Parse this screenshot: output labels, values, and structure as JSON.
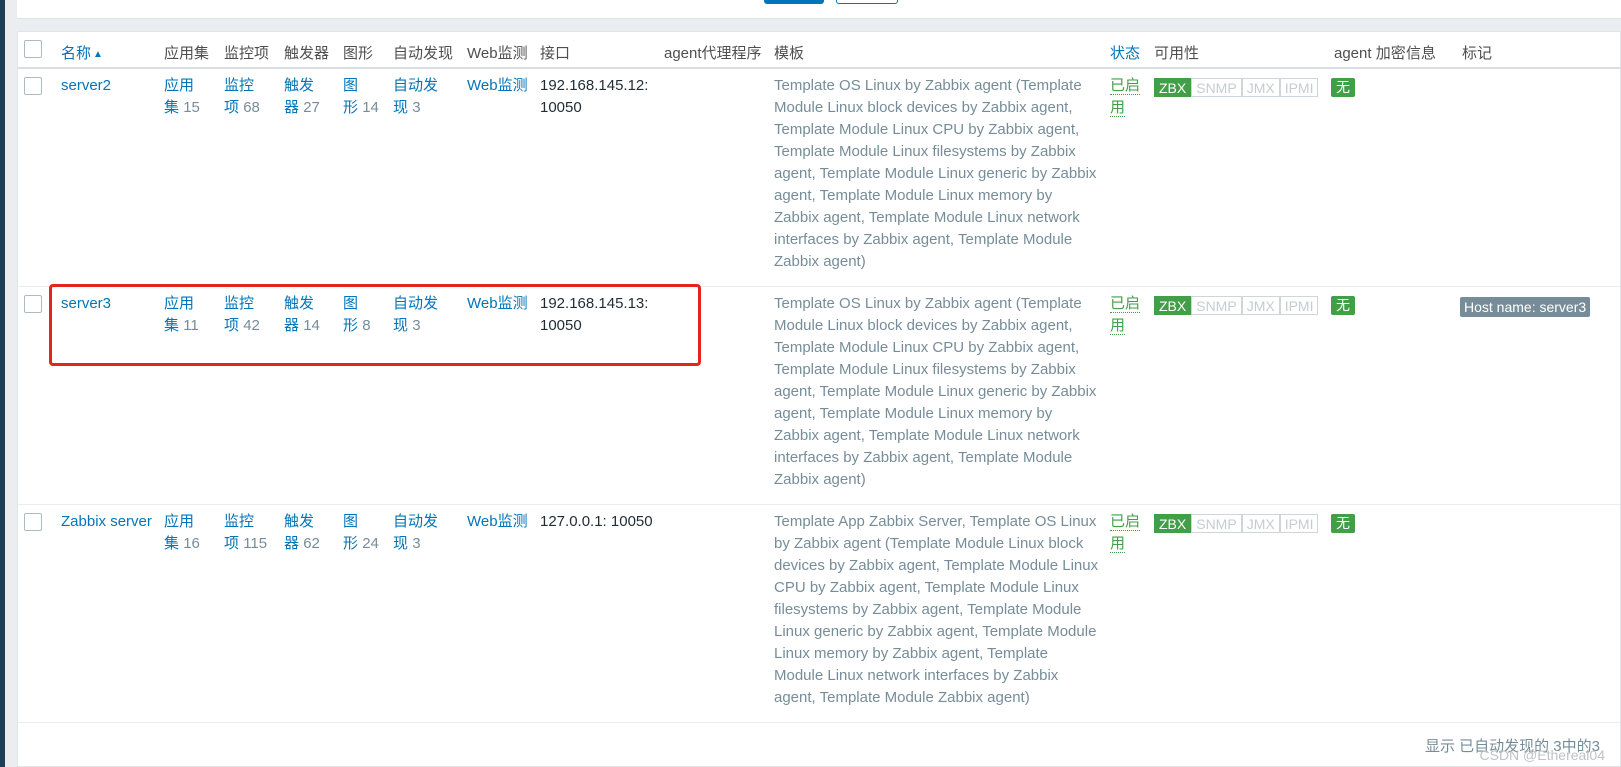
{
  "header": {
    "name": "名称",
    "applications": "应用集",
    "items": "监控项",
    "triggers": "触发器",
    "graphs": "图形",
    "discovery": "自动发现",
    "web": "Web监测",
    "interface": "接口",
    "proxy": "agent代理程序",
    "templates": "模板",
    "status": "状态",
    "availability": "可用性",
    "encryption": "agent 加密",
    "info": "信息",
    "tags": "标记"
  },
  "rows": [
    {
      "name": "server2",
      "apps": {
        "l1": "应用",
        "l2": "集",
        "count": "15"
      },
      "items": {
        "l1": "监控",
        "l2": "项",
        "count": "68"
      },
      "triggers": {
        "l1": "触发",
        "l2": "器",
        "count": "27"
      },
      "graphs": {
        "l1": "图",
        "l2": "形",
        "count": "14"
      },
      "discovery": {
        "l1": "自动发",
        "l2": "现",
        "count": "3"
      },
      "web": "Web监测",
      "interface": {
        "l1": "192.168.145.12:",
        "l2": "10050"
      },
      "status": {
        "l1": "已启",
        "l2": "用"
      },
      "encryption": "无",
      "tag": ""
    },
    {
      "name": "server3",
      "apps": {
        "l1": "应用",
        "l2": "集",
        "count": "11"
      },
      "items": {
        "l1": "监控",
        "l2": "项",
        "count": "42"
      },
      "triggers": {
        "l1": "触发",
        "l2": "器",
        "count": "14"
      },
      "graphs": {
        "l1": "图",
        "l2": "形",
        "count": "8"
      },
      "discovery": {
        "l1": "自动发",
        "l2": "现",
        "count": "3"
      },
      "web": "Web监测",
      "interface": {
        "l1": "192.168.145.13:",
        "l2": "10050"
      },
      "status": {
        "l1": "已启",
        "l2": "用"
      },
      "encryption": "无",
      "tag": "Host name: server3"
    },
    {
      "name": "Zabbix server",
      "apps": {
        "l1": "应用",
        "l2": "集",
        "count": "16"
      },
      "items": {
        "l1": "监控",
        "l2": "项",
        "count": "115"
      },
      "triggers": {
        "l1": "触发",
        "l2": "器",
        "count": "62"
      },
      "graphs": {
        "l1": "图",
        "l2": "形",
        "count": "24"
      },
      "discovery": {
        "l1": "自动发",
        "l2": "现",
        "count": "3"
      },
      "web": "Web监测",
      "interface": {
        "l1": "127.0.0.1: 10050",
        "l2": ""
      },
      "status": {
        "l1": "已启",
        "l2": "用"
      },
      "encryption": "无",
      "tag": ""
    }
  ],
  "templates_linux": [
    "Template OS Linux by Zabbix agent (Template",
    "Module Linux block devices by Zabbix agent,",
    "Template Module Linux CPU by Zabbix agent,",
    "Template Module Linux filesystems by Zabbix",
    "agent, Template Module Linux generic by Zabbix",
    "agent, Template Module Linux memory by",
    "Zabbix agent, Template Module Linux network",
    "interfaces by Zabbix agent, Template Module",
    "Zabbix agent)"
  ],
  "templates_zabbix_server": [
    "Template App Zabbix Server, Template OS Linux",
    "by Zabbix agent (Template Module Linux block",
    "devices by Zabbix agent, Template Module Linux",
    "CPU by Zabbix agent, Template Module Linux",
    "filesystems by Zabbix agent, Template Module",
    "Linux generic by Zabbix agent, Template Module",
    "Linux memory by Zabbix agent, Template",
    "Module Linux network interfaces by Zabbix",
    "agent, Template Module Zabbix agent)"
  ],
  "availability_badges": [
    "ZBX",
    "SNMP",
    "JMX",
    "IPMI"
  ],
  "footer": "显示 已自动发现的 3中的3",
  "watermark": "CSDN @Ethereal04",
  "colors": {
    "link": "#0275b8",
    "enabled": "#429e47",
    "muted": "#768d99",
    "highlight": "#e5251b"
  }
}
